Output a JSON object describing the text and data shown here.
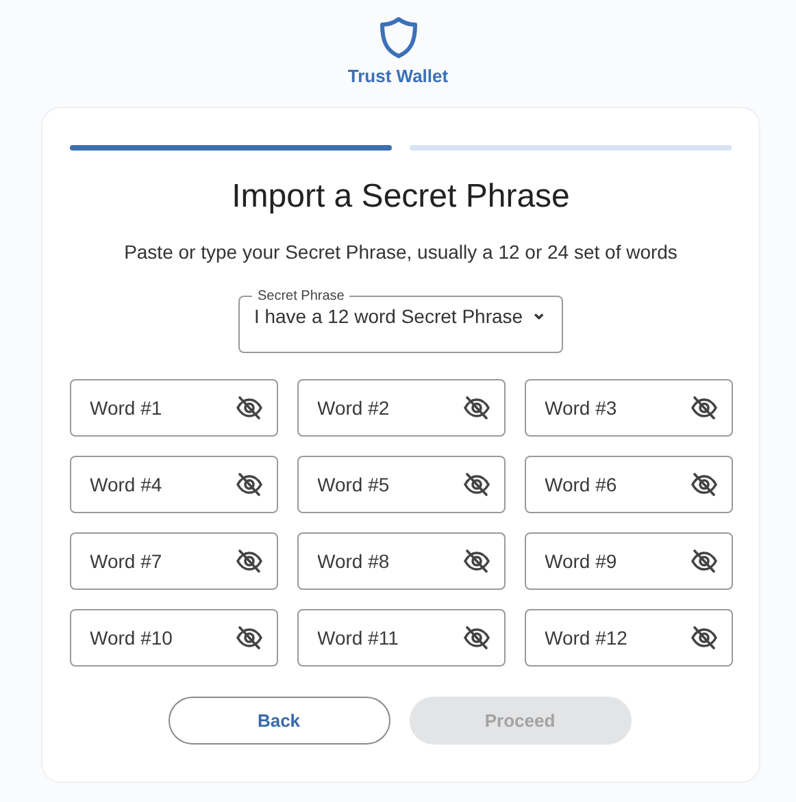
{
  "brand": {
    "name": "Trust Wallet"
  },
  "steps": [
    {
      "active": true
    },
    {
      "active": false
    }
  ],
  "title": "Import a Secret Phrase",
  "subtitle": "Paste or type your Secret Phrase, usually a 12 or 24 set of words",
  "select": {
    "label": "Secret Phrase",
    "value": "I have a 12 word Secret Phrase",
    "caret": "⌄"
  },
  "words": [
    {
      "placeholder": "Word #1"
    },
    {
      "placeholder": "Word #2"
    },
    {
      "placeholder": "Word #3"
    },
    {
      "placeholder": "Word #4"
    },
    {
      "placeholder": "Word #5"
    },
    {
      "placeholder": "Word #6"
    },
    {
      "placeholder": "Word #7"
    },
    {
      "placeholder": "Word #8"
    },
    {
      "placeholder": "Word #9"
    },
    {
      "placeholder": "Word #10"
    },
    {
      "placeholder": "Word #11"
    },
    {
      "placeholder": "Word #12"
    }
  ],
  "buttons": [
    {
      "label": "Back",
      "disabled": false
    },
    {
      "label": "Proceed",
      "disabled": true
    }
  ]
}
